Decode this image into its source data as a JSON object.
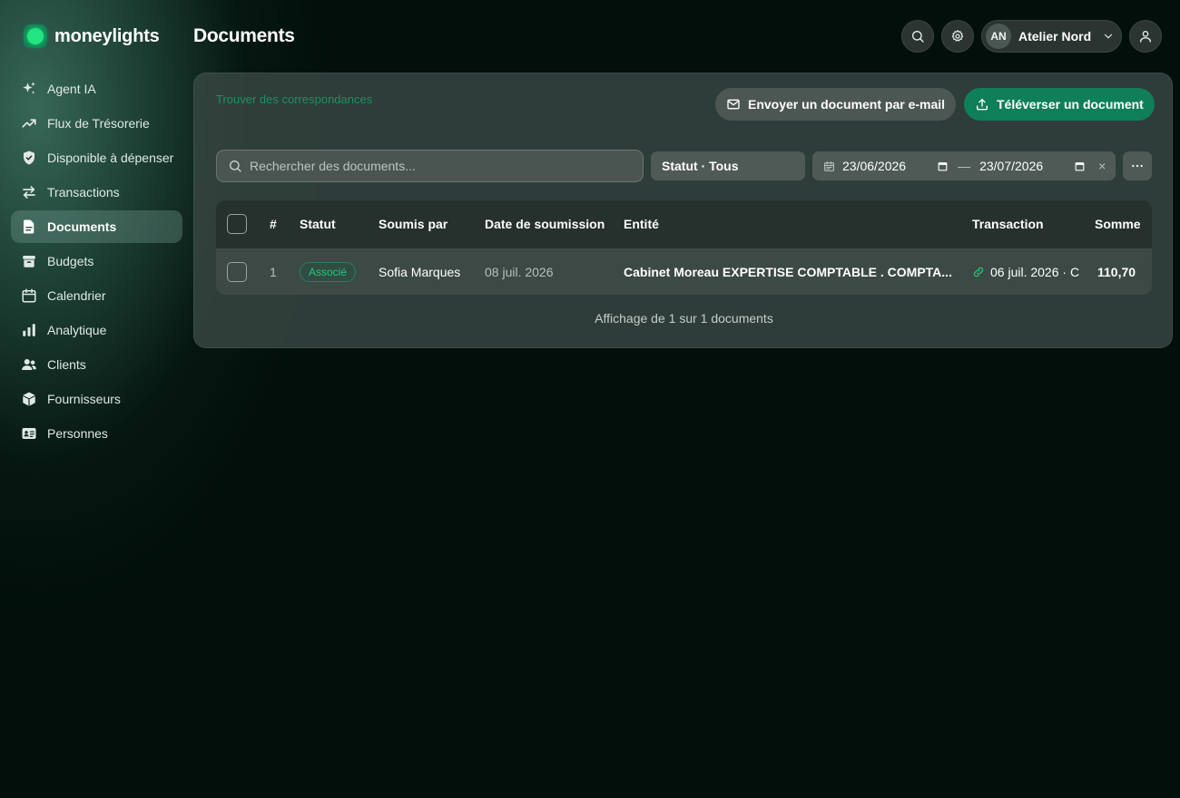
{
  "brand": {
    "name": "moneylights",
    "accent": "#22e57f"
  },
  "sidebar": {
    "items": [
      {
        "label": "Agent IA",
        "icon": "sparkles-icon"
      },
      {
        "label": "Flux de Trésorerie",
        "icon": "trend-up-icon"
      },
      {
        "label": "Disponible à dépenser",
        "icon": "shield-check-icon"
      },
      {
        "label": "Transactions",
        "icon": "arrows-exchange-icon"
      },
      {
        "label": "Documents",
        "icon": "document-icon",
        "active": true
      },
      {
        "label": "Budgets",
        "icon": "archive-box-icon"
      },
      {
        "label": "Calendrier",
        "icon": "calendar-icon"
      },
      {
        "label": "Analytique",
        "icon": "bar-chart-icon"
      },
      {
        "label": "Clients",
        "icon": "users-icon"
      },
      {
        "label": "Fournisseurs",
        "icon": "cube-icon"
      },
      {
        "label": "Personnes",
        "icon": "id-card-icon"
      }
    ]
  },
  "header": {
    "title": "Documents",
    "account": {
      "initials": "AN",
      "name": "Atelier Nord"
    }
  },
  "panel": {
    "match_link": "Trouver des correspondances",
    "email_button": "Envoyer un document par e-mail",
    "upload_button": "Téléverser un document",
    "search_placeholder": "Rechercher des documents...",
    "status_filter": "Statut · Tous",
    "date_from": "23/06/2026",
    "date_to": "23/07/2026",
    "date_separator": "—",
    "clear_symbol": "×"
  },
  "table": {
    "columns": [
      "#",
      "Statut",
      "Soumis par",
      "Date de soumission",
      "Entité",
      "Transaction",
      "Somme"
    ],
    "rows": [
      {
        "index": "1",
        "status": "Associé",
        "submitted_by": "Sofia Marques",
        "submitted_date": "08 juil. 2026",
        "entity": "Cabinet Moreau EXPERTISE COMPTABLE . COMPTA...",
        "transaction": "06 juil. 2026 · C",
        "amount": "110,70"
      }
    ],
    "footer": "Affichage de 1 sur 1 documents"
  }
}
